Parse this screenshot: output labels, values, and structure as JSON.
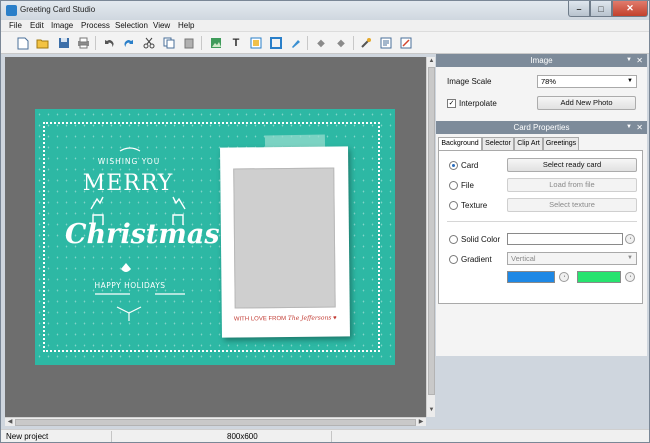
{
  "window": {
    "title": "Greeting Card Studio"
  },
  "menu": [
    "File",
    "Edit",
    "Image",
    "Process",
    "Selection",
    "View",
    "Help"
  ],
  "toolbar": {
    "icons": [
      "new-icon",
      "open-icon",
      "save-icon",
      "print-icon",
      "undo-icon",
      "redo-icon",
      "cut-icon",
      "copy-icon",
      "paste-icon",
      "insert-image-icon",
      "text-icon",
      "image-icon",
      "frame-icon",
      "brush-icon",
      "move-up-icon",
      "move-down-icon",
      "effects-icon",
      "preview-icon",
      "export-icon"
    ]
  },
  "card": {
    "line1": "WISHING YOU",
    "line2": "MERRY",
    "line3": "Christmas",
    "line4": "HAPPY HOLIDAYS",
    "caption": "WITH LOVE FROM",
    "signature": "The Jeffersons",
    "colors": {
      "background": "#2db8a4",
      "text": "#ffffff",
      "accent": "#c23b33"
    }
  },
  "image_panel": {
    "title": "Image",
    "scale_label": "Image Scale",
    "scale_value": "78%",
    "interpolate_label": "Interpolate",
    "interpolate_checked": true,
    "add_photo_label": "Add New Photo"
  },
  "card_panel": {
    "title": "Card Properties",
    "tabs": [
      "Background",
      "Selector",
      "Clip Art",
      "Greetings"
    ],
    "active_tab": "Background",
    "options": {
      "card": {
        "label": "Card",
        "button": "Select ready card",
        "selected": true
      },
      "file": {
        "label": "File",
        "button": "Load from file"
      },
      "texture": {
        "label": "Texture",
        "button": "Select texture"
      },
      "solid": {
        "label": "Solid Color"
      },
      "gradient": {
        "label": "Gradient",
        "value": "Vertical",
        "color1": "#1e88e5",
        "color2": "#27e36f"
      }
    }
  },
  "status": {
    "left": "New project",
    "size": "800x600"
  }
}
